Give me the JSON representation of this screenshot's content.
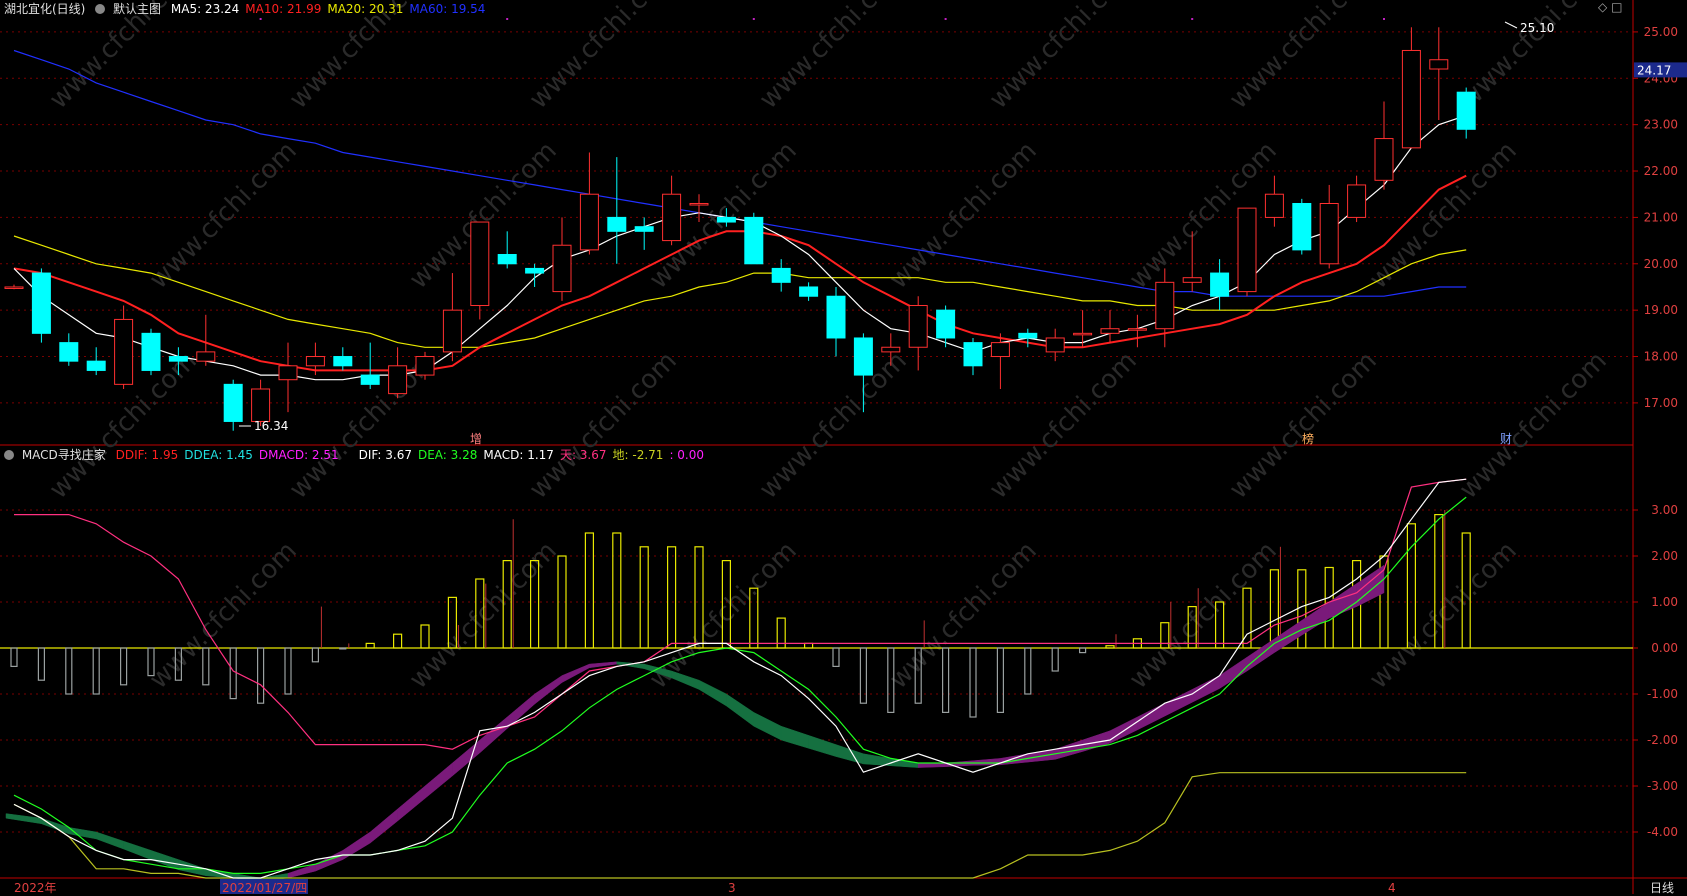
{
  "header": {
    "stock_title": "湖北宜化(日线)",
    "main_chart_name": "默认主图",
    "ma_items": [
      {
        "text": "MA5: 23.24",
        "color": "#ffffff"
      },
      {
        "text": "MA10: 21.99",
        "color": "#ff2020"
      },
      {
        "text": "MA20: 20.31",
        "color": "#e8e800"
      },
      {
        "text": "MA60: 19.54",
        "color": "#2030ff"
      }
    ],
    "window_icons": [
      "◇",
      "□"
    ]
  },
  "macd_header": {
    "name": "MACD寻找庄家",
    "items": [
      {
        "text": "DDIF: 1.95",
        "color": "#ff2020"
      },
      {
        "text": "DDEA: 1.45",
        "color": "#20e0e0"
      },
      {
        "text": "DMACD: 2.51",
        "color": "#ff20ff"
      },
      {
        "text": "DIF: 3.67",
        "color": "#ffffff"
      },
      {
        "text": "DEA: 3.28",
        "color": "#20ff20"
      },
      {
        "text": "MACD: 1.17",
        "color": "#ffffff"
      },
      {
        "text": "天: 3.67",
        "color": "#ff3080"
      },
      {
        "text": "地: -2.71",
        "color": "#c8d020"
      },
      {
        "text": ": 0.00",
        "color": "#ff20ff"
      }
    ]
  },
  "price_axis": {
    "ticks": [
      "25.00",
      "24.00",
      "23.00",
      "22.00",
      "21.00",
      "20.00",
      "19.00",
      "18.00",
      "17.00"
    ],
    "current_price": "24.17"
  },
  "macd_axis": {
    "ticks": [
      "3.00",
      "2.00",
      "1.00",
      "0.00",
      "-1.00",
      "-2.00",
      "-3.00",
      "-4.00"
    ]
  },
  "date_axis": {
    "labels": [
      "2022年",
      "2022/01/27/四",
      "3",
      "4"
    ],
    "period": "日线"
  },
  "annotations": {
    "high_label": "25.10",
    "low_label": "16.34",
    "events": [
      "增",
      "榜",
      "财"
    ]
  },
  "watermark": "www.cfchi.com",
  "colors": {
    "up": "#ff3030",
    "down": "#00ffff",
    "grid": "#7a0000",
    "axis": "#c00000"
  },
  "chart_data": {
    "type": "candlestick",
    "ylim": [
      16.2,
      25.3
    ],
    "candles": [
      {
        "o": 19.5,
        "c": 19.5,
        "h": 19.55,
        "l": 19.45
      },
      {
        "o": 19.8,
        "c": 18.5,
        "h": 19.9,
        "l": 18.3
      },
      {
        "o": 18.3,
        "c": 17.9,
        "h": 18.5,
        "l": 17.8
      },
      {
        "o": 17.9,
        "c": 17.7,
        "h": 18.2,
        "l": 17.6
      },
      {
        "o": 17.4,
        "c": 18.8,
        "h": 19.1,
        "l": 17.3
      },
      {
        "o": 18.5,
        "c": 17.7,
        "h": 18.6,
        "l": 17.6
      },
      {
        "o": 18.0,
        "c": 17.9,
        "h": 18.2,
        "l": 17.6
      },
      {
        "o": 17.9,
        "c": 18.1,
        "h": 18.9,
        "l": 17.8
      },
      {
        "o": 17.4,
        "c": 16.6,
        "h": 17.5,
        "l": 16.4
      },
      {
        "o": 16.6,
        "c": 17.3,
        "h": 17.5,
        "l": 16.5
      },
      {
        "o": 17.5,
        "c": 17.8,
        "h": 18.3,
        "l": 16.8
      },
      {
        "o": 17.8,
        "c": 18.0,
        "h": 18.3,
        "l": 17.6
      },
      {
        "o": 18.0,
        "c": 17.8,
        "h": 18.2,
        "l": 17.7
      },
      {
        "o": 17.6,
        "c": 17.4,
        "h": 18.3,
        "l": 17.3
      },
      {
        "o": 17.2,
        "c": 17.8,
        "h": 18.2,
        "l": 17.1
      },
      {
        "o": 17.6,
        "c": 18.0,
        "h": 18.1,
        "l": 17.5
      },
      {
        "o": 18.1,
        "c": 19.0,
        "h": 19.8,
        "l": 17.9
      },
      {
        "o": 19.1,
        "c": 20.9,
        "h": 20.9,
        "l": 18.8
      },
      {
        "o": 20.2,
        "c": 20.0,
        "h": 20.7,
        "l": 19.9
      },
      {
        "o": 19.9,
        "c": 19.8,
        "h": 20.0,
        "l": 19.5
      },
      {
        "o": 19.4,
        "c": 20.4,
        "h": 21.0,
        "l": 19.2
      },
      {
        "o": 20.3,
        "c": 21.5,
        "h": 22.4,
        "l": 20.2
      },
      {
        "o": 21.0,
        "c": 20.7,
        "h": 22.3,
        "l": 20.0
      },
      {
        "o": 20.8,
        "c": 20.7,
        "h": 21.0,
        "l": 20.3
      },
      {
        "o": 20.5,
        "c": 21.5,
        "h": 21.9,
        "l": 20.4
      },
      {
        "o": 21.3,
        "c": 21.3,
        "h": 21.5,
        "l": 20.9
      },
      {
        "o": 21.0,
        "c": 20.9,
        "h": 21.2,
        "l": 20.8
      },
      {
        "o": 21.0,
        "c": 20.0,
        "h": 21.1,
        "l": 20.0
      },
      {
        "o": 19.9,
        "c": 19.6,
        "h": 20.1,
        "l": 19.4
      },
      {
        "o": 19.5,
        "c": 19.3,
        "h": 19.6,
        "l": 19.2
      },
      {
        "o": 19.3,
        "c": 18.4,
        "h": 19.5,
        "l": 18.0
      },
      {
        "o": 18.4,
        "c": 17.6,
        "h": 18.5,
        "l": 16.8
      },
      {
        "o": 18.1,
        "c": 18.2,
        "h": 18.5,
        "l": 17.8
      },
      {
        "o": 18.2,
        "c": 19.1,
        "h": 19.3,
        "l": 17.7
      },
      {
        "o": 19.0,
        "c": 18.4,
        "h": 19.1,
        "l": 18.2
      },
      {
        "o": 18.3,
        "c": 17.8,
        "h": 18.4,
        "l": 17.6
      },
      {
        "o": 18.0,
        "c": 18.3,
        "h": 18.5,
        "l": 17.3
      },
      {
        "o": 18.5,
        "c": 18.4,
        "h": 18.6,
        "l": 18.2
      },
      {
        "o": 18.1,
        "c": 18.4,
        "h": 18.6,
        "l": 17.9
      },
      {
        "o": 18.5,
        "c": 18.5,
        "h": 19.0,
        "l": 18.2
      },
      {
        "o": 18.5,
        "c": 18.6,
        "h": 19.0,
        "l": 18.3
      },
      {
        "o": 18.6,
        "c": 18.6,
        "h": 18.9,
        "l": 18.2
      },
      {
        "o": 18.6,
        "c": 19.6,
        "h": 19.9,
        "l": 18.2
      },
      {
        "o": 19.6,
        "c": 19.7,
        "h": 20.7,
        "l": 19.4
      },
      {
        "o": 19.8,
        "c": 19.3,
        "h": 20.1,
        "l": 19.0
      },
      {
        "o": 19.4,
        "c": 21.2,
        "h": 21.2,
        "l": 19.3
      },
      {
        "o": 21.0,
        "c": 21.5,
        "h": 21.9,
        "l": 20.8
      },
      {
        "o": 21.3,
        "c": 20.3,
        "h": 21.4,
        "l": 20.2
      },
      {
        "o": 20.0,
        "c": 21.3,
        "h": 21.7,
        "l": 19.9
      },
      {
        "o": 21.0,
        "c": 21.7,
        "h": 21.9,
        "l": 20.9
      },
      {
        "o": 21.8,
        "c": 22.7,
        "h": 23.5,
        "l": 21.6
      },
      {
        "o": 22.5,
        "c": 24.6,
        "h": 25.1,
        "l": 22.5
      },
      {
        "o": 24.2,
        "c": 24.4,
        "h": 25.1,
        "l": 23.1
      },
      {
        "o": 23.7,
        "c": 22.9,
        "h": 23.8,
        "l": 22.7
      }
    ],
    "ma5": [
      19.9,
      19.3,
      18.9,
      18.5,
      18.4,
      18.2,
      18.0,
      17.9,
      17.8,
      17.6,
      17.6,
      17.5,
      17.5,
      17.6,
      17.6,
      17.7,
      18.1,
      18.6,
      19.1,
      19.7,
      20.1,
      20.3,
      20.6,
      20.8,
      21.0,
      21.1,
      21.0,
      20.9,
      20.6,
      20.2,
      19.6,
      19.0,
      18.6,
      18.5,
      18.3,
      18.1,
      18.3,
      18.4,
      18.3,
      18.3,
      18.5,
      18.6,
      18.8,
      19.1,
      19.3,
      19.6,
      20.2,
      20.5,
      20.7,
      21.2,
      21.7,
      22.5,
      23.0,
      23.2
    ],
    "ma10": [
      19.9,
      19.8,
      19.6,
      19.4,
      19.2,
      18.9,
      18.5,
      18.3,
      18.1,
      17.9,
      17.8,
      17.7,
      17.7,
      17.7,
      17.7,
      17.7,
      17.8,
      18.2,
      18.5,
      18.8,
      19.1,
      19.3,
      19.6,
      19.9,
      20.2,
      20.5,
      20.7,
      20.7,
      20.6,
      20.4,
      20.0,
      19.6,
      19.3,
      19.0,
      18.7,
      18.5,
      18.4,
      18.3,
      18.2,
      18.2,
      18.3,
      18.4,
      18.5,
      18.6,
      18.7,
      18.9,
      19.3,
      19.6,
      19.8,
      20.0,
      20.4,
      21.0,
      21.6,
      21.9
    ],
    "ma20": [
      20.6,
      20.4,
      20.2,
      20.0,
      19.9,
      19.8,
      19.6,
      19.4,
      19.2,
      19.0,
      18.8,
      18.7,
      18.6,
      18.5,
      18.3,
      18.2,
      18.2,
      18.2,
      18.3,
      18.4,
      18.6,
      18.8,
      19.0,
      19.2,
      19.3,
      19.5,
      19.6,
      19.8,
      19.8,
      19.7,
      19.7,
      19.7,
      19.7,
      19.7,
      19.6,
      19.6,
      19.5,
      19.4,
      19.3,
      19.2,
      19.2,
      19.1,
      19.1,
      19.0,
      19.0,
      19.0,
      19.0,
      19.1,
      19.2,
      19.4,
      19.7,
      20.0,
      20.2,
      20.3
    ],
    "ma60": [
      24.6,
      24.4,
      24.2,
      23.9,
      23.7,
      23.5,
      23.3,
      23.1,
      23.0,
      22.8,
      22.7,
      22.6,
      22.4,
      22.3,
      22.2,
      22.1,
      22.0,
      21.9,
      21.8,
      21.7,
      21.6,
      21.5,
      21.4,
      21.3,
      21.2,
      21.1,
      21.0,
      20.9,
      20.8,
      20.7,
      20.6,
      20.5,
      20.4,
      20.3,
      20.2,
      20.1,
      20.0,
      19.9,
      19.8,
      19.7,
      19.6,
      19.5,
      19.4,
      19.4,
      19.3,
      19.3,
      19.3,
      19.3,
      19.3,
      19.3,
      19.3,
      19.4,
      19.5,
      19.5
    ],
    "macd_ylim": [
      -5.0,
      4.0
    ],
    "macd_hist": [
      -0.4,
      -0.7,
      -1.0,
      -1.0,
      -0.8,
      -0.6,
      -0.7,
      -0.8,
      -1.1,
      -1.2,
      -1.0,
      -0.3,
      -0.02,
      0.1,
      0.3,
      0.5,
      1.1,
      1.5,
      1.9,
      1.9,
      2.0,
      2.5,
      2.5,
      2.2,
      2.2,
      2.2,
      1.9,
      1.3,
      0.65,
      0.1,
      -0.4,
      -1.2,
      -1.4,
      -1.2,
      -1.4,
      -1.5,
      -1.4,
      -1.0,
      -0.5,
      -0.1,
      0.05,
      0.2,
      0.55,
      0.9,
      1.0,
      1.3,
      1.7,
      1.7,
      1.75,
      1.9,
      2.0,
      2.7,
      2.9,
      2.5
    ],
    "macd_hist_up_tip": [
      null,
      null,
      null,
      null,
      null,
      null,
      null,
      null,
      null,
      null,
      null,
      0.9,
      0.1,
      null,
      null,
      null,
      0.5,
      1.4,
      2.8,
      null,
      null,
      null,
      null,
      null,
      null,
      null,
      null,
      null,
      null,
      null,
      null,
      null,
      null,
      0.6,
      null,
      null,
      null,
      null,
      null,
      null,
      0.3,
      null,
      1.0,
      1.3,
      null,
      null,
      2.2,
      null,
      null,
      null,
      null,
      null,
      3.0,
      null
    ],
    "dif": [
      -3.4,
      -3.7,
      -4.1,
      -4.4,
      -4.6,
      -4.6,
      -4.7,
      -4.8,
      -5.0,
      -5.0,
      -4.8,
      -4.6,
      -4.5,
      -4.5,
      -4.4,
      -4.2,
      -3.7,
      -1.8,
      -1.7,
      -1.4,
      -1.0,
      -0.6,
      -0.4,
      -0.3,
      -0.1,
      0.1,
      0.1,
      -0.3,
      -0.6,
      -1.1,
      -1.7,
      -2.7,
      -2.5,
      -2.3,
      -2.5,
      -2.7,
      -2.5,
      -2.3,
      -2.2,
      -2.1,
      -2.0,
      -1.6,
      -1.2,
      -1.0,
      -0.6,
      0.3,
      0.6,
      0.9,
      1.1,
      1.5,
      2.0,
      2.8,
      3.6,
      3.67
    ],
    "dea": [
      -3.2,
      -3.5,
      -3.9,
      -4.4,
      -4.6,
      -4.7,
      -4.8,
      -4.8,
      -4.9,
      -4.9,
      -4.8,
      -4.7,
      -4.5,
      -4.5,
      -4.4,
      -4.3,
      -4.0,
      -3.2,
      -2.5,
      -2.2,
      -1.8,
      -1.3,
      -0.9,
      -0.6,
      -0.3,
      -0.1,
      0.0,
      -0.1,
      -0.5,
      -0.9,
      -1.5,
      -2.2,
      -2.4,
      -2.5,
      -2.5,
      -2.5,
      -2.5,
      -2.4,
      -2.3,
      -2.2,
      -2.1,
      -1.9,
      -1.6,
      -1.3,
      -1.0,
      -0.4,
      0.1,
      0.4,
      0.6,
      1.0,
      1.5,
      2.2,
      2.8,
      3.28
    ],
    "tian": [
      2.9,
      2.9,
      2.9,
      2.7,
      2.3,
      2.0,
      1.5,
      0.4,
      -0.5,
      -0.8,
      -1.4,
      -2.1,
      -2.1,
      -2.1,
      -2.1,
      -2.1,
      -2.2,
      -1.9,
      -1.7,
      -1.5,
      -1.0,
      -0.5,
      -0.4,
      -0.3,
      0.1,
      0.1,
      0.1,
      0.1,
      0.1,
      0.1,
      0.1,
      0.1,
      0.1,
      0.1,
      0.1,
      0.1,
      0.1,
      0.1,
      0.1,
      0.1,
      0.1,
      0.1,
      0.1,
      0.1,
      0.1,
      0.1,
      0.5,
      0.7,
      1.0,
      1.2,
      1.7,
      3.5,
      3.6,
      3.67
    ],
    "di": [
      -3.4,
      -3.7,
      -4.1,
      -4.8,
      -4.8,
      -4.9,
      -4.9,
      -5.0,
      -5.0,
      -5.0,
      -5.0,
      -5.0,
      -5.0,
      -5.0,
      -5.0,
      -5.0,
      -5.0,
      -5.0,
      -5.0,
      -5.0,
      -5.0,
      -5.0,
      -5.0,
      -5.0,
      -5.0,
      -5.0,
      -5.0,
      -5.0,
      -5.0,
      -5.0,
      -5.0,
      -5.0,
      -5.0,
      -5.0,
      -5.0,
      -5.0,
      -4.8,
      -4.5,
      -4.5,
      -4.5,
      -4.4,
      -4.2,
      -3.8,
      -2.8,
      -2.71,
      -2.71,
      -2.71,
      -2.71,
      -2.71,
      -2.71,
      -2.71,
      -2.71,
      -2.71,
      -2.71
    ],
    "band_top": [
      -3.6,
      -3.7,
      -3.9,
      -4.0,
      -4.2,
      -4.4,
      -4.6,
      -4.8,
      -4.9,
      -5.0,
      -4.9,
      -4.7,
      -4.4,
      -4.0,
      -3.5,
      -3.0,
      -2.5,
      -2.0,
      -1.5,
      -1.0,
      -0.6,
      -0.35,
      -0.3,
      -0.35,
      -0.5,
      -0.7,
      -1.0,
      -1.4,
      -1.7,
      -1.9,
      -2.1,
      -2.3,
      -2.4,
      -2.5,
      -2.5,
      -2.45,
      -2.4,
      -2.3,
      -2.2,
      -2.0,
      -1.8,
      -1.5,
      -1.2,
      -0.9,
      -0.6,
      -0.2,
      0.2,
      0.6,
      1.0,
      1.4,
      1.8
    ],
    "band_width": [
      0.1,
      0.12,
      0.14,
      0.15,
      0.17,
      0.2,
      0.22,
      0.15,
      0.1,
      0.08,
      0.1,
      0.15,
      0.2,
      0.24,
      0.26,
      0.27,
      0.28,
      0.28,
      0.25,
      0.22,
      0.15,
      0.08,
      0.05,
      0.1,
      0.15,
      0.2,
      0.26,
      0.3,
      0.3,
      0.28,
      0.26,
      0.22,
      0.16,
      0.1,
      0.08,
      0.1,
      0.14,
      0.18,
      0.22,
      0.25,
      0.27,
      0.28,
      0.28,
      0.28,
      0.28,
      0.3,
      0.3,
      0.32,
      0.35,
      0.5,
      0.6
    ],
    "band_sign": [
      -1,
      -1,
      -1,
      -1,
      -1,
      -1,
      -1,
      -1,
      -1,
      -1,
      1,
      1,
      1,
      1,
      1,
      1,
      1,
      1,
      1,
      1,
      1,
      1,
      -1,
      -1,
      -1,
      -1,
      -1,
      -1,
      -1,
      -1,
      -1,
      -1,
      -1,
      1,
      1,
      1,
      1,
      1,
      1,
      1,
      1,
      1,
      1,
      1,
      1,
      1,
      1,
      1,
      1,
      1,
      1
    ]
  }
}
